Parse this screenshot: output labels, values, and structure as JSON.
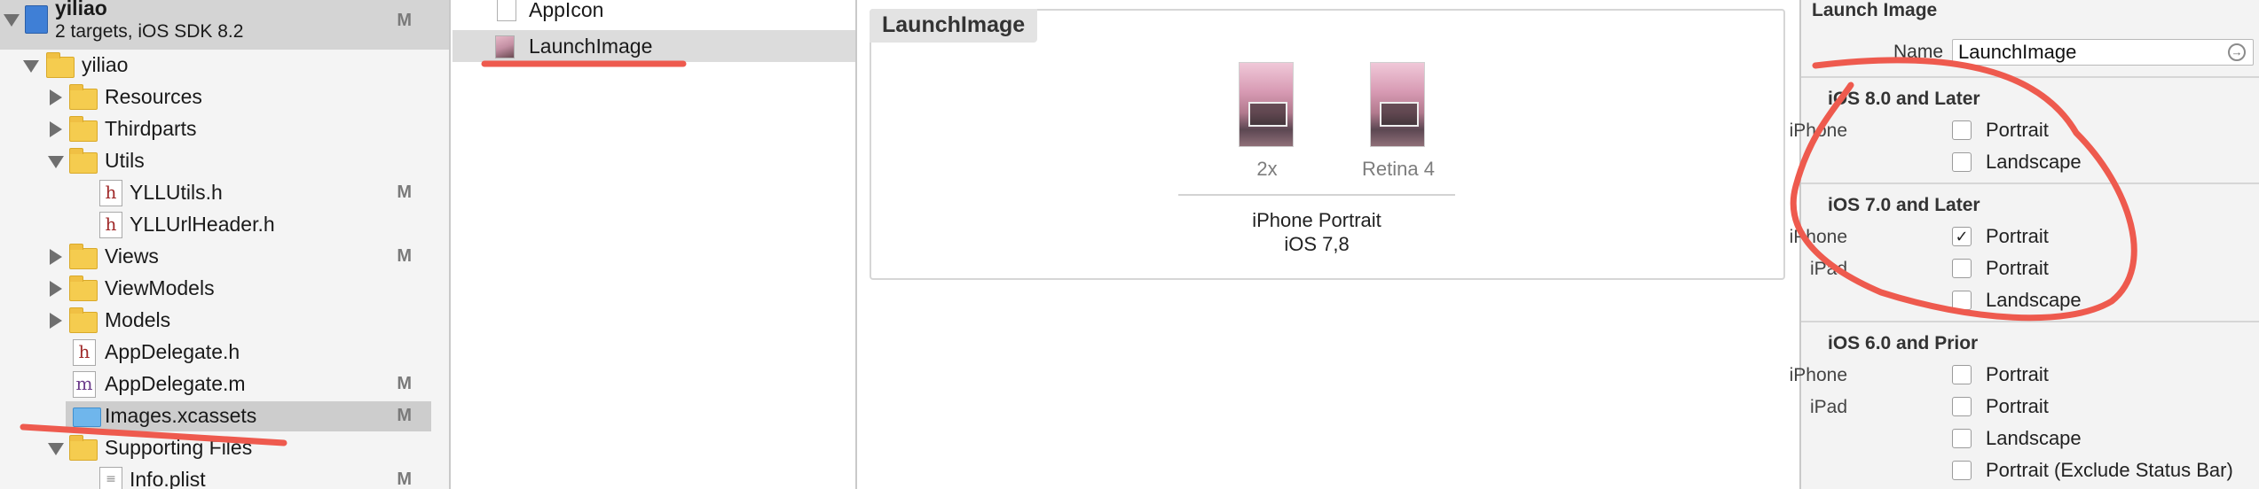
{
  "project": {
    "name": "yiliao",
    "subtitle": "2 targets, iOS SDK 8.2",
    "badge": "M"
  },
  "navigator": {
    "items": [
      {
        "label": "yiliao",
        "kind": "folder",
        "badge": ""
      },
      {
        "label": "Resources",
        "kind": "folder",
        "badge": ""
      },
      {
        "label": "Thirdparts",
        "kind": "folder",
        "badge": ""
      },
      {
        "label": "Utils",
        "kind": "folder",
        "badge": ""
      },
      {
        "label": "YLLUtils.h",
        "kind": "header",
        "badge": "M"
      },
      {
        "label": "YLLUrlHeader.h",
        "kind": "header",
        "badge": ""
      },
      {
        "label": "Views",
        "kind": "folder",
        "badge": "M"
      },
      {
        "label": "ViewModels",
        "kind": "folder",
        "badge": ""
      },
      {
        "label": "Models",
        "kind": "folder",
        "badge": ""
      },
      {
        "label": "AppDelegate.h",
        "kind": "header",
        "badge": ""
      },
      {
        "label": "AppDelegate.m",
        "kind": "impl",
        "badge": "M"
      },
      {
        "label": "Images.xcassets",
        "kind": "assets",
        "badge": "M"
      },
      {
        "label": "Supporting Files",
        "kind": "folder",
        "badge": ""
      },
      {
        "label": "Info.plist",
        "kind": "plist",
        "badge": "M"
      }
    ],
    "file_icon_glyphs": {
      "header": "h",
      "impl": "m",
      "plist": "≡"
    }
  },
  "asset_list": {
    "items": [
      {
        "label": "AppIcon"
      },
      {
        "label": "LaunchImage"
      }
    ]
  },
  "canvas": {
    "set_title": "LaunchImage",
    "slots": [
      {
        "label": "2x"
      },
      {
        "label": "Retina 4"
      }
    ],
    "group_line1": "iPhone Portrait",
    "group_line2": "iOS 7,8"
  },
  "inspector": {
    "title": "Launch Image",
    "name_label": "Name",
    "name_value": "LaunchImage",
    "arrow_glyph": "→",
    "check_glyph": "✓",
    "sections": [
      {
        "title": "iOS 8.0 and Later",
        "rows": [
          {
            "device": "iPhone",
            "label": "Portrait",
            "checked": false
          },
          {
            "device": "",
            "label": "Landscape",
            "checked": false
          }
        ]
      },
      {
        "title": "iOS 7.0 and Later",
        "rows": [
          {
            "device": "iPhone",
            "label": "Portrait",
            "checked": true
          },
          {
            "device": "iPad",
            "label": "Portrait",
            "checked": false
          },
          {
            "device": "",
            "label": "Landscape",
            "checked": false
          }
        ]
      },
      {
        "title": "iOS 6.0 and Prior",
        "rows": [
          {
            "device": "iPhone",
            "label": "Portrait",
            "checked": false
          },
          {
            "device": "iPad",
            "label": "Portrait",
            "checked": false
          },
          {
            "device": "",
            "label": "Landscape",
            "checked": false
          },
          {
            "device": "",
            "label": "Portrait (Exclude Status Bar)",
            "checked": false
          }
        ]
      }
    ]
  },
  "colors": {
    "annotation": "#ee5a4e",
    "selection_sidebar": "#cdcdcd",
    "folder": "#f5cc4f",
    "assets_icon": "#6fb6ec"
  }
}
